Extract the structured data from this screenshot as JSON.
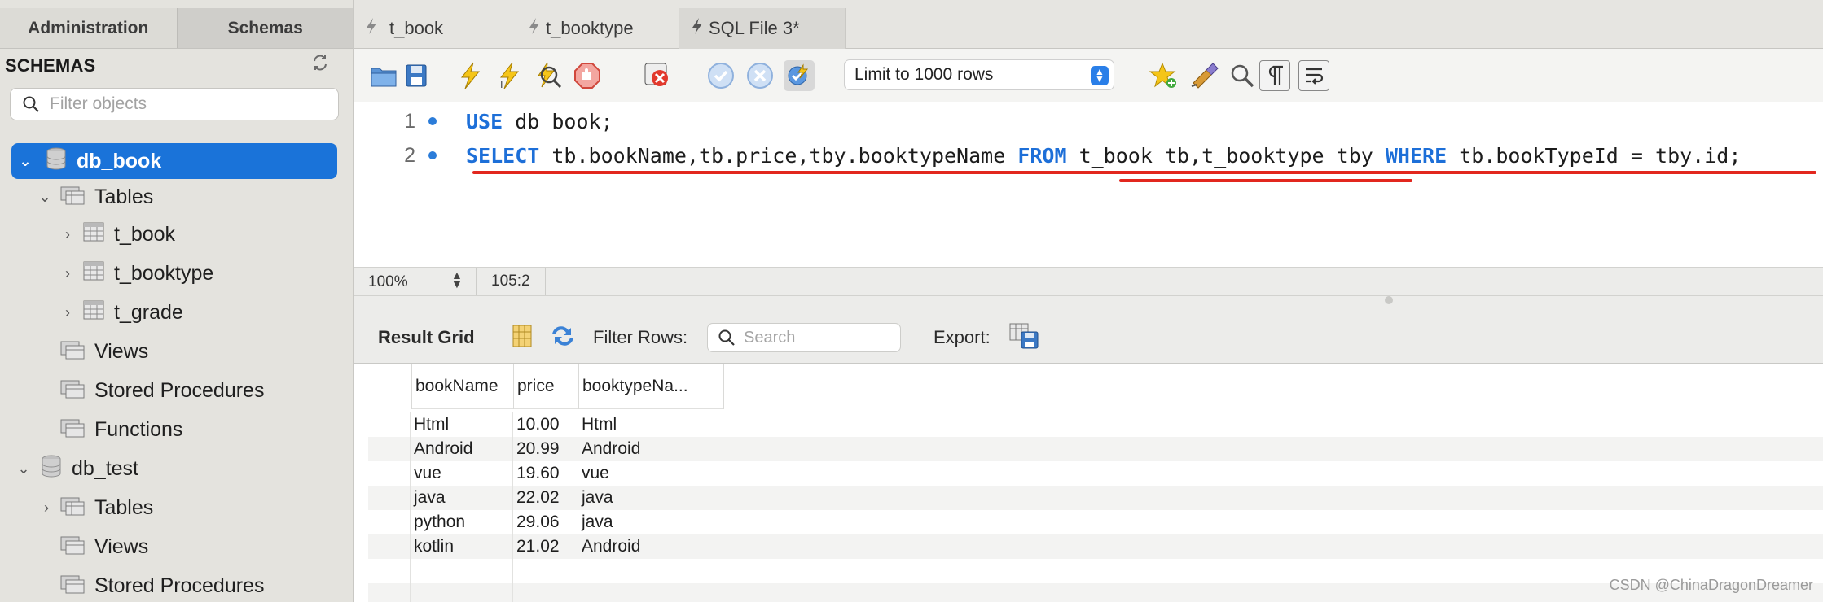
{
  "sidebar": {
    "tabs": [
      "Administration",
      "Schemas"
    ],
    "active_tab": "Schemas",
    "section_title": "SCHEMAS",
    "filter_placeholder": "Filter objects",
    "tree": [
      {
        "label": "db_book",
        "level": 0,
        "type": "schema",
        "expanded": true,
        "selected": true
      },
      {
        "label": "Tables",
        "level": 1,
        "type": "folder",
        "expanded": true
      },
      {
        "label": "t_book",
        "level": 2,
        "type": "table"
      },
      {
        "label": "t_booktype",
        "level": 2,
        "type": "table"
      },
      {
        "label": "t_grade",
        "level": 2,
        "type": "table"
      },
      {
        "label": "Views",
        "level": 1,
        "type": "folder"
      },
      {
        "label": "Stored Procedures",
        "level": 1,
        "type": "folder"
      },
      {
        "label": "Functions",
        "level": 1,
        "type": "folder"
      },
      {
        "label": "db_test",
        "level": 0,
        "type": "schema",
        "expanded": true
      },
      {
        "label": "Tables",
        "level": 1,
        "type": "folder",
        "expanded": false
      },
      {
        "label": "Views",
        "level": 1,
        "type": "folder"
      },
      {
        "label": "Stored Procedures",
        "level": 1,
        "type": "folder"
      }
    ]
  },
  "tabs": [
    {
      "label": "t_book"
    },
    {
      "label": "t_booktype"
    },
    {
      "label": "SQL File 3*",
      "active": true
    }
  ],
  "toolbar": {
    "limit_label": "Limit to 1000 rows",
    "icons": [
      "open-file-icon",
      "save-icon",
      "execute-icon",
      "execute-current-icon",
      "explain-icon",
      "stop-icon",
      "toggle-error-icon",
      "commit-icon",
      "rollback-icon",
      "autocommit-icon",
      "bookmark-icon",
      "beautify-icon",
      "find-icon",
      "invisible-chars-icon",
      "wrap-icon"
    ]
  },
  "editor": {
    "lines": [
      {
        "number": "1",
        "tokens": [
          {
            "t": "USE",
            "kw": true
          },
          {
            "t": " db_book;"
          }
        ]
      },
      {
        "number": "2",
        "tokens": [
          {
            "t": "SELECT",
            "kw": true
          },
          {
            "t": " tb.bookName,tb.price,tby.booktypeName "
          },
          {
            "t": "FROM",
            "kw": true
          },
          {
            "t": " t_book tb,t_booktype tby "
          },
          {
            "t": "WHERE",
            "kw": true
          },
          {
            "t": " tb.bookTypeId = tby.id;"
          }
        ]
      }
    ],
    "annotation_color": "#e2271e"
  },
  "status": {
    "zoom": "100%",
    "cursor": "105:2"
  },
  "result": {
    "title": "Result Grid",
    "filter_label": "Filter Rows:",
    "search_placeholder": "Search",
    "export_label": "Export:",
    "columns": [
      "bookName",
      "price",
      "booktypeNa..."
    ],
    "rows": [
      [
        "Html",
        "10.00",
        "Html"
      ],
      [
        "Android",
        "20.99",
        "Android"
      ],
      [
        "vue",
        "19.60",
        "vue"
      ],
      [
        "java",
        "22.02",
        "java"
      ],
      [
        "python",
        "29.06",
        "java"
      ],
      [
        "kotlin",
        "21.02",
        "Android"
      ]
    ]
  },
  "watermark": "CSDN @ChinaDragonDreamer",
  "colors": {
    "selection": "#1a73d9",
    "keyword": "#1d6fd8"
  }
}
